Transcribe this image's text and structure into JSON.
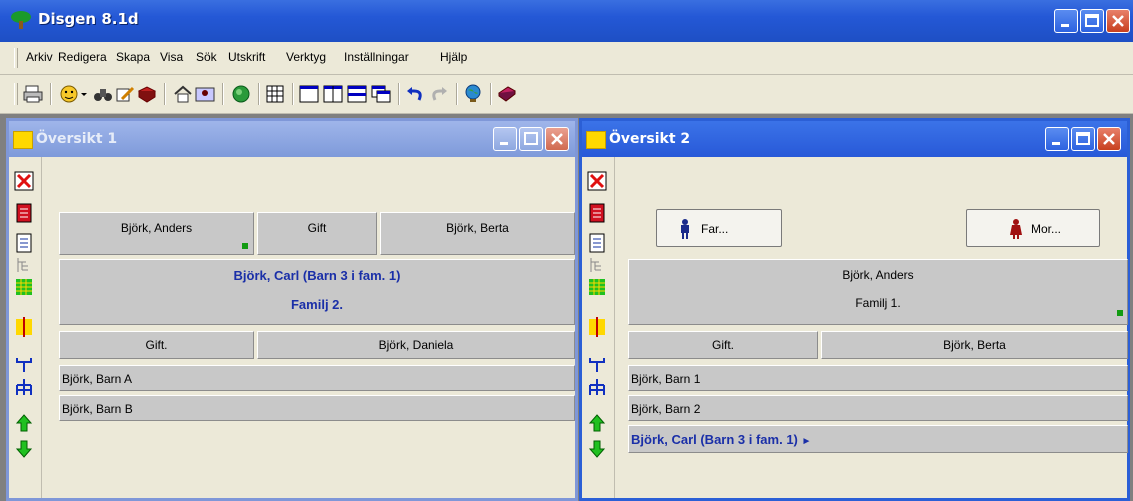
{
  "window": {
    "title": "Disgen 8.1d"
  },
  "menu": [
    "Arkiv",
    "Redigera",
    "Skapa",
    "Visa",
    "Sök",
    "Utskrift",
    "Verktyg",
    "Inställningar",
    "Hjälp"
  ],
  "win1": {
    "title": "Översikt 1",
    "parent1": "Björk, Anders",
    "relation": "Gift",
    "parent2": "Björk, Berta",
    "focus_name": "Björk, Carl (Barn 3 i fam. 1)",
    "focus_family": "Familj 2.",
    "spouse_relation": "Gift.",
    "spouse": "Björk, Daniela",
    "children": [
      "Björk, Barn A",
      "Björk, Barn B"
    ]
  },
  "win2": {
    "title": "Översikt 2",
    "far_button": "Far...",
    "mor_button": "Mor...",
    "focus_name": "Björk, Anders",
    "focus_family": "Familj 1.",
    "spouse_relation": "Gift.",
    "spouse": "Björk, Berta",
    "children": [
      "Björk, Barn 1",
      "Björk, Barn 2"
    ],
    "selected_child": "Björk, Carl (Barn 3 i fam. 1)",
    "selected_arrow": "►"
  },
  "colors": {
    "title_blue": "#2458d6",
    "focus_text": "#1a2fa8",
    "indicator_green": "#129b12"
  }
}
